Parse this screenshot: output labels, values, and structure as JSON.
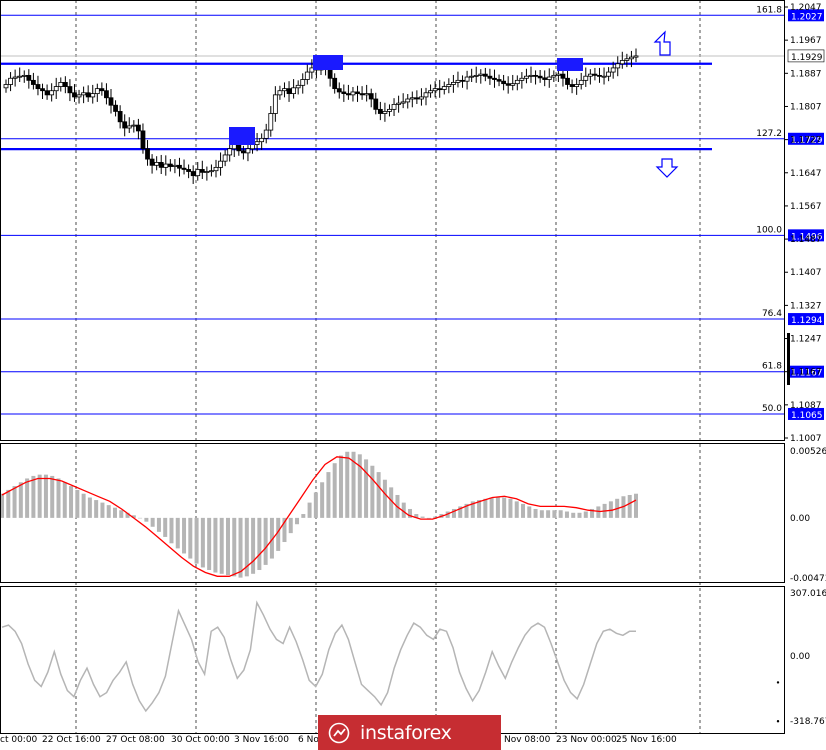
{
  "chart_data": [
    {
      "type": "candlestick",
      "title": "",
      "ylim": [
        1.1007,
        1.2047
      ],
      "y_tick_labels": [
        "1.2047",
        "1.1967",
        "1.1887",
        "1.1807",
        "1.1727",
        "1.1647",
        "1.1567",
        "1.1487",
        "1.1407",
        "1.1327",
        "1.1247",
        "1.1167",
        "1.1087",
        "1.1007"
      ],
      "current_price": "1.1929",
      "fibonacci_levels": [
        {
          "level": "161.8",
          "price": "1.2027"
        },
        {
          "level": "127.2",
          "price": "1.1729"
        },
        {
          "level": "100.0",
          "price": "1.1496"
        },
        {
          "level": "76.4",
          "price": "1.1294"
        },
        {
          "level": "61.8",
          "price": "1.1167"
        },
        {
          "level": "50.0",
          "price": "1.1065"
        }
      ],
      "horizontal_lines": [
        1.191,
        1.1704
      ],
      "arrows": [
        {
          "direction": "up"
        },
        {
          "direction": "down"
        }
      ],
      "highlight_boxes": 3,
      "close_series": [
        1.186,
        1.1875,
        1.1878,
        1.188,
        1.1882,
        1.187,
        1.186,
        1.185,
        1.1845,
        1.1835,
        1.1845,
        1.1855,
        1.1865,
        1.1855,
        1.184,
        1.183,
        1.1835,
        1.184,
        1.183,
        1.1838,
        1.185,
        1.1845,
        1.1828,
        1.181,
        1.1795,
        1.177,
        1.1755,
        1.176,
        1.1762,
        1.1748,
        1.1705,
        1.168,
        1.1665,
        1.1672,
        1.166,
        1.1668,
        1.1662,
        1.1665,
        1.1658,
        1.1655,
        1.165,
        1.164,
        1.1655,
        1.1648,
        1.165,
        1.1652,
        1.166,
        1.1675,
        1.169,
        1.1705,
        1.1715,
        1.17,
        1.1695,
        1.1705,
        1.1715,
        1.1722,
        1.173,
        1.175,
        1.179,
        1.1835,
        1.1845,
        1.185,
        1.1838,
        1.1852,
        1.1858,
        1.1872,
        1.189,
        1.19,
        1.1895,
        1.1905,
        1.1898,
        1.1875,
        1.185,
        1.1842,
        1.1838,
        1.1835,
        1.1842,
        1.1838,
        1.1835,
        1.1838,
        1.1825,
        1.18,
        1.179,
        1.1795,
        1.18,
        1.1812,
        1.1815,
        1.1818,
        1.1825,
        1.1828,
        1.1825,
        1.183,
        1.184,
        1.1845,
        1.185,
        1.1848,
        1.1855,
        1.186,
        1.1865,
        1.187,
        1.1868,
        1.1878,
        1.188,
        1.1882,
        1.1885,
        1.188,
        1.1875,
        1.1872,
        1.1868,
        1.1862,
        1.1858,
        1.1862,
        1.187,
        1.1875,
        1.188,
        1.1882,
        1.188,
        1.1876,
        1.1872,
        1.1878,
        1.1882,
        1.1885,
        1.1875,
        1.186,
        1.1855,
        1.186,
        1.187,
        1.188,
        1.1885,
        1.1882,
        1.188,
        1.188,
        1.189,
        1.19,
        1.191,
        1.1918,
        1.1922,
        1.1926,
        1.1929
      ],
      "panels": [
        {
          "name": "MACD",
          "y_tick_labels": [
            "0.00526",
            "0.00",
            "-0.00473"
          ],
          "histogram": [
            0.0019,
            0.0022,
            0.0025,
            0.0028,
            0.0031,
            0.0033,
            0.0034,
            0.0034,
            0.0033,
            0.0031,
            0.0028,
            0.0025,
            0.0022,
            0.0019,
            0.0016,
            0.0014,
            0.0012,
            0.001,
            0.0008,
            0.0006,
            0.0004,
            0.0002,
            0.0,
            -0.0003,
            -0.0007,
            -0.0011,
            -0.0015,
            -0.002,
            -0.0024,
            -0.0028,
            -0.0032,
            -0.0036,
            -0.0039,
            -0.0041,
            -0.0043,
            -0.0044,
            -0.0045,
            -0.0046,
            -0.0047,
            -0.0046,
            -0.0044,
            -0.0041,
            -0.0037,
            -0.0032,
            -0.0026,
            -0.0019,
            -0.0012,
            -0.0005,
            0.0003,
            0.0012,
            0.002,
            0.0028,
            0.0036,
            0.0043,
            0.0049,
            0.0052,
            0.0052,
            0.005,
            0.0046,
            0.0041,
            0.0036,
            0.003,
            0.0024,
            0.0018,
            0.0012,
            0.0007,
            0.0003,
            0.0001,
            0.0,
            0.0001,
            0.0003,
            0.0005,
            0.0007,
            0.0009,
            0.0011,
            0.0013,
            0.0014,
            0.0015,
            0.0016,
            0.0016,
            0.0016,
            0.0015,
            0.0013,
            0.0011,
            0.0009,
            0.0007,
            0.0006,
            0.0006,
            0.0006,
            0.0006,
            0.0005,
            0.0004,
            0.0004,
            0.0005,
            0.0007,
            0.0009,
            0.0011,
            0.0013,
            0.0015,
            0.0017,
            0.0018,
            0.0019
          ],
          "signal": [
            0.0018,
            0.0023,
            0.0028,
            0.0031,
            0.0031,
            0.0029,
            0.0025,
            0.0021,
            0.0017,
            0.0013,
            0.0007,
            0.0,
            -0.0007,
            -0.0015,
            -0.0023,
            -0.0031,
            -0.0038,
            -0.0043,
            -0.0046,
            -0.0046,
            -0.0042,
            -0.0034,
            -0.0024,
            -0.0012,
            0.0002,
            0.0016,
            0.003,
            0.0042,
            0.0048,
            0.0047,
            0.004,
            0.003,
            0.0019,
            0.0009,
            0.0002,
            -0.0001,
            -0.0001,
            0.0002,
            0.0006,
            0.001,
            0.0013,
            0.0016,
            0.0017,
            0.0015,
            0.0011,
            0.0009,
            0.0009,
            0.0009,
            0.0008,
            0.0006,
            0.0005,
            0.0006,
            0.0009,
            0.0014
          ]
        },
        {
          "name": "CCI",
          "y_tick_labels": [
            "307.0161",
            "0.00",
            "-318.767"
          ],
          "line": [
            140,
            150,
            120,
            60,
            -40,
            -120,
            -150,
            -80,
            20,
            -90,
            -170,
            -200,
            -120,
            -60,
            -140,
            -200,
            -180,
            -120,
            -80,
            -30,
            -140,
            -220,
            -270,
            -230,
            -180,
            -100,
            60,
            220,
            150,
            80,
            -30,
            -90,
            120,
            140,
            90,
            -20,
            -110,
            -70,
            30,
            260,
            200,
            130,
            80,
            60,
            140,
            70,
            -20,
            -120,
            -150,
            -90,
            30,
            110,
            150,
            80,
            -30,
            -140,
            -170,
            -200,
            -240,
            -180,
            -60,
            30,
            100,
            160,
            140,
            100,
            80,
            130,
            120,
            40,
            -80,
            -160,
            -220,
            -170,
            -80,
            20,
            -50,
            -110,
            -30,
            40,
            100,
            140,
            160,
            140,
            60,
            -30,
            -120,
            -180,
            -210,
            -140,
            -40,
            60,
            120,
            130,
            110,
            100,
            120,
            120
          ],
          "dots_at": [
            -130,
            -320
          ]
        }
      ],
      "x_tick_labels": [
        "ct 00:00",
        "22 Oct 16:00",
        "27 Oct 08:00",
        "30 Oct 00:00",
        "3 Nov 16:00",
        "6 Nov",
        "Nov 08:00",
        "23 Nov 00:00",
        "25 Nov 16:00"
      ]
    }
  ],
  "watermark": {
    "text": "instaforex",
    "icon": "instaforex-logo-icon",
    "background": "#c62d32"
  },
  "colors": {
    "level": "#0000ff",
    "line": "#000000",
    "histogram": "#b5b5b5",
    "signal": "#ff0000",
    "cci": "#b5b5b5",
    "box": "#1a1aff"
  }
}
